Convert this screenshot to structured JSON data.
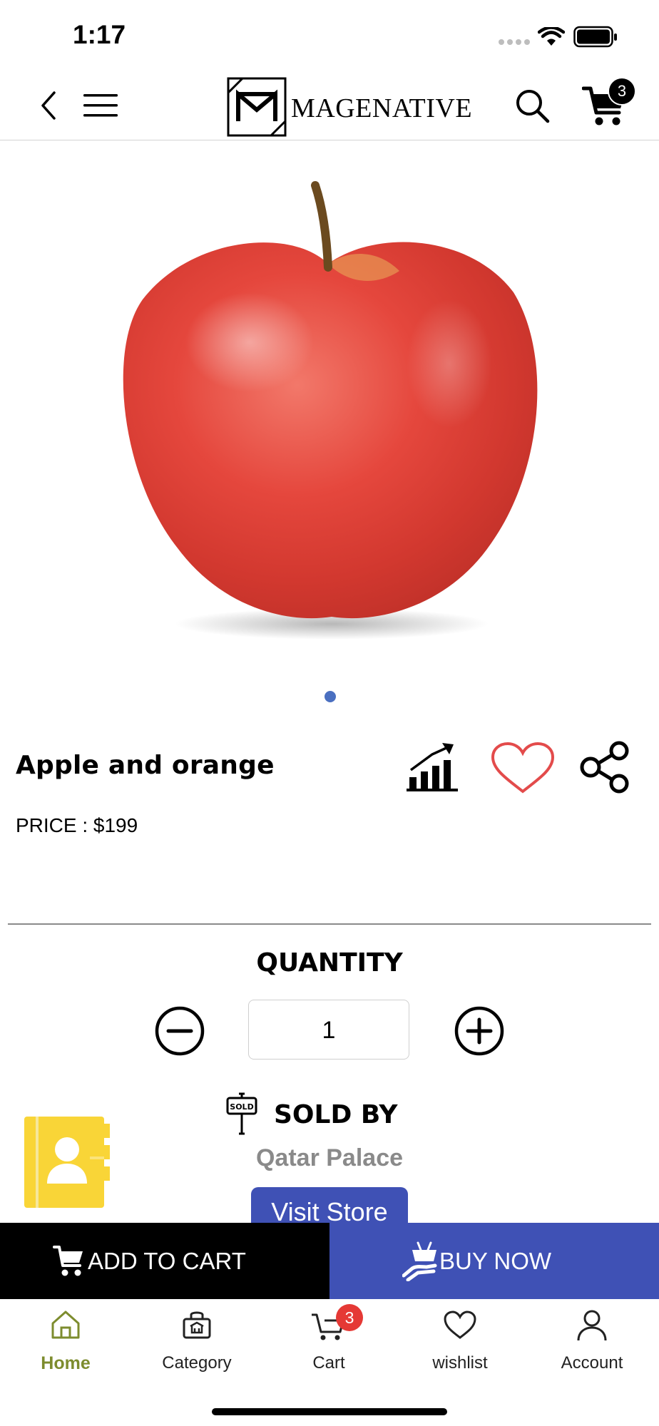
{
  "status_bar": {
    "time": "1:17"
  },
  "header": {
    "brand": "MageNative",
    "brand_display": "MAGENATIVE",
    "cart_count": "3"
  },
  "product": {
    "image": "red-apple-photo",
    "name": "Apple and orange",
    "price": "PRICE : $199",
    "image_count": 1,
    "active_image": 1
  },
  "quantity": {
    "label": "QUANTITY",
    "value": "1"
  },
  "seller": {
    "label": "SOLD BY",
    "sign_text": "SOLD",
    "store_name": "Qatar Palace",
    "visit_label": "Visit Store"
  },
  "actions": {
    "add_to_cart": "ADD TO CART",
    "buy_now": "BUY NOW"
  },
  "tab_bar": {
    "items": [
      {
        "label": "Home",
        "icon": "home-icon",
        "active": true
      },
      {
        "label": "Category",
        "icon": "shop-icon",
        "active": false
      },
      {
        "label": "Cart",
        "icon": "cart-icon",
        "active": false,
        "badge": "3"
      },
      {
        "label": "wishlist",
        "icon": "heart-icon",
        "active": false
      },
      {
        "label": "Account",
        "icon": "user-icon",
        "active": false
      }
    ]
  },
  "colors": {
    "accent": "#3f51b5",
    "home_active": "#7d8c2e",
    "badge_red": "#e53935",
    "heart_red": "#e34b4b",
    "contact_yellow": "#f9d537"
  }
}
